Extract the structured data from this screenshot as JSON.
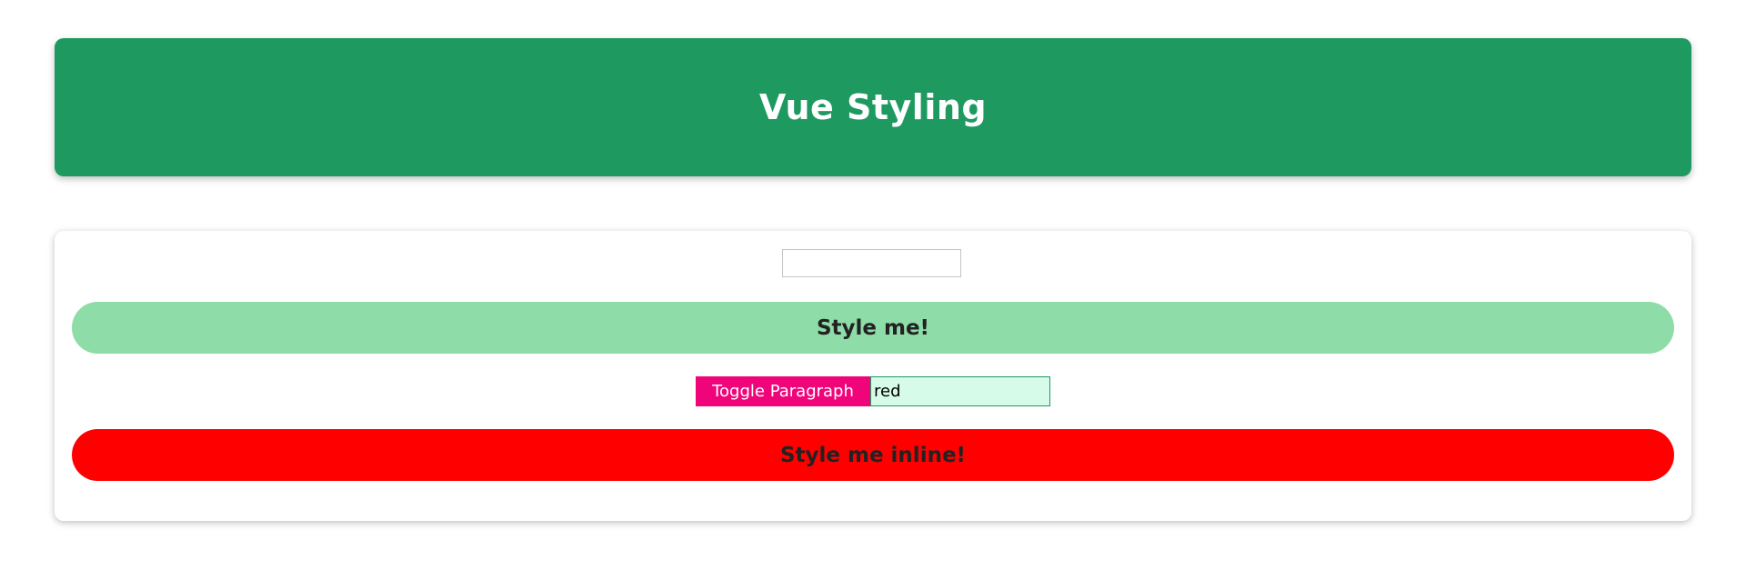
{
  "header": {
    "title": "Vue Styling"
  },
  "main": {
    "class_input": {
      "value": "",
      "placeholder": ""
    },
    "styled_paragraph": {
      "text": "Style me!"
    },
    "toggle_button": {
      "label": "Toggle Paragraph"
    },
    "color_input": {
      "value": "red"
    },
    "inline_paragraph": {
      "text": "Style me inline!"
    }
  },
  "colors": {
    "header_bg": "#1e9a60",
    "styled_paragraph_bg": "#8edca7",
    "toggle_button_bg": "#f0047a",
    "color_input_bg": "#d6fbe9",
    "inline_paragraph_bg": "#ff0000"
  }
}
